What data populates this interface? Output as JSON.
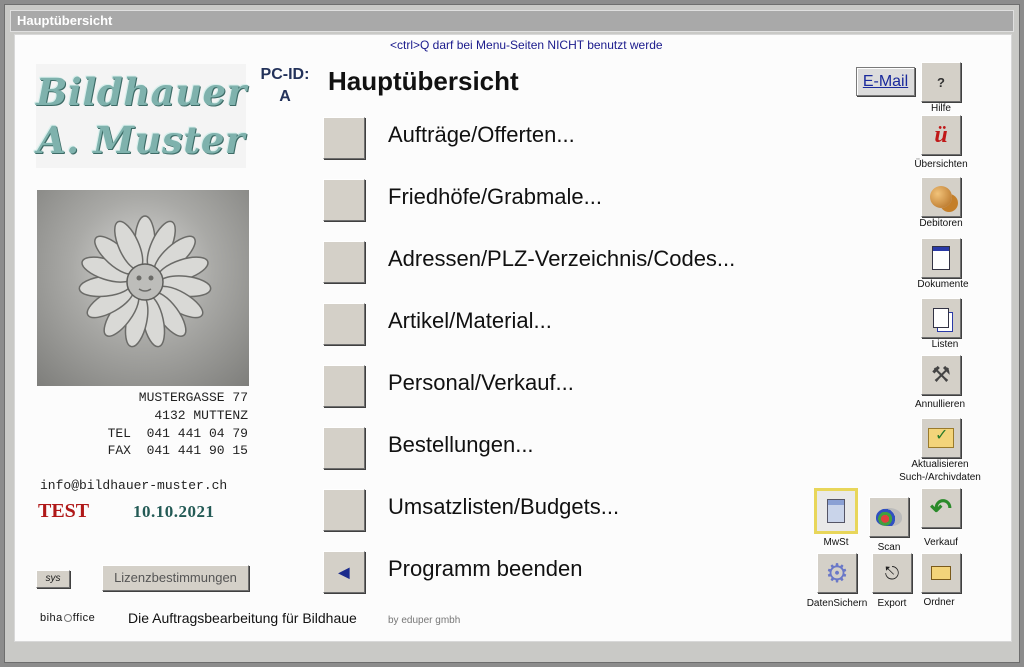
{
  "window": {
    "title": "Hauptübersicht"
  },
  "warning_text": "<ctrl>Q darf bei Menu-Seiten NICHT benutzt werde",
  "logo": {
    "line1": "Bildhauer",
    "line2": "A. Muster"
  },
  "address": {
    "street": "MUSTERGASSE 77",
    "city": "4132 MUTTENZ",
    "tel": "TEL  041 441 04 79",
    "fax": "FAX  041 441 90 15",
    "email": "info@bildhauer-muster.ch"
  },
  "status": {
    "test_label": "TEST",
    "date": "10.10.2021"
  },
  "footer_buttons": {
    "sys": "sys",
    "lizenz": "Lizenzbestimmungen"
  },
  "footer": {
    "brand_left": "biha",
    "brand_right": "ffice",
    "tagline": "Die Auftragsbearbeitung für Bildhaue",
    "credit": "by eduper gmbh"
  },
  "pcid": {
    "label": "PC-ID:",
    "value": "A"
  },
  "page_title": "Hauptübersicht",
  "menu": [
    {
      "label": "Aufträge/Offerten..."
    },
    {
      "label": "Friedhöfe/Grabmale..."
    },
    {
      "label": "Adressen/PLZ-Verzeichnis/Codes..."
    },
    {
      "label": "Artikel/Material..."
    },
    {
      "label": "Personal/Verkauf..."
    },
    {
      "label": "Bestellungen..."
    },
    {
      "label": "Umsatzlisten/Budgets..."
    },
    {
      "label": "Programm beenden"
    }
  ],
  "email_button": "E-Mail",
  "tools": {
    "hilfe": "Hilfe",
    "uebersichten": "Übersichten",
    "debitoren": "Debitoren",
    "dokumente": "Dokumente",
    "listen": "Listen",
    "annullieren": "Annullieren",
    "aktualisieren_1": "Aktualisieren",
    "aktualisieren_2": "Such-/Archivdaten",
    "mwst": "MwSt",
    "scan": "Scan",
    "verkauf": "Verkauf",
    "datensichern": "DatenSichern",
    "export": "Export",
    "ordner": "Ordner"
  },
  "colors": {
    "accent_logo": "#7fb2ad",
    "test_red": "#b01818",
    "link_blue": "#1a2a9c"
  }
}
